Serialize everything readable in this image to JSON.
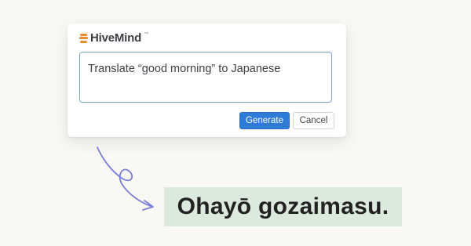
{
  "brand": {
    "name": "HiveMind",
    "trademark": "™",
    "logo_icon": "stacked-bars-logo",
    "logo_color": "#e8892b"
  },
  "prompt": {
    "text": "Translate “good morning” to Japanese",
    "border_color": "#7aa3d8"
  },
  "actions": {
    "generate_label": "Generate",
    "cancel_label": "Cancel",
    "generate_color": "#2f7bd8"
  },
  "arrow_icon": "hand-drawn-loop-arrow",
  "arrow_color": "#7b7fd8",
  "result": {
    "text": "Ohayō gozaimasu.",
    "background_color": "#dce9dd"
  }
}
